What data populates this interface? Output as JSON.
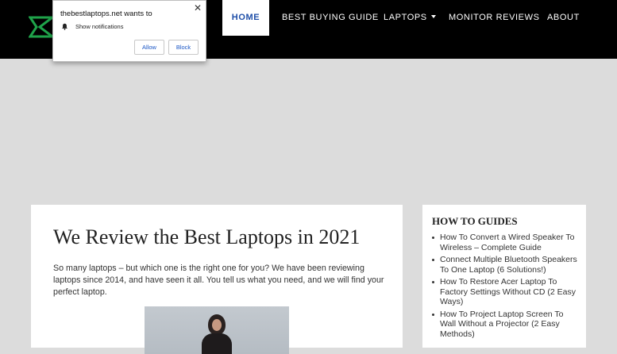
{
  "nav": {
    "items": [
      {
        "label": "HOME",
        "active": true
      },
      {
        "label": "BEST BUYING GUIDE",
        "active": false
      },
      {
        "label": "LAPTOPS",
        "active": false,
        "has_dropdown": true
      },
      {
        "label": "MONITOR REVIEWS",
        "active": false
      },
      {
        "label": "ABOUT",
        "active": false
      }
    ]
  },
  "popup": {
    "title": "thebestlaptops.net wants to",
    "permission": "Show notifications",
    "allow_label": "Allow",
    "block_label": "Block",
    "close_glyph": "✕",
    "icon": "bell-icon"
  },
  "main": {
    "title": "We Review the Best Laptops in 2021",
    "intro": "So many laptops – but which one is the right one for you? We have been reviewing laptops since 2014, and have seen it all. You tell us what you need, and we will find your perfect laptop."
  },
  "sidebar": {
    "title": "HOW TO GUIDES",
    "items": [
      "How To Convert a Wired Speaker To Wireless – Complete Guide",
      "Connect Multiple Bluetooth Speakers To One Laptop (6 Solutions!)",
      "How To Restore Acer Laptop To Factory Settings Without CD (2 Easy Ways)",
      "How To Project Laptop Screen To Wall Without a Projector (2 Easy Methods)"
    ]
  },
  "colors": {
    "topbar": "#000000",
    "page_bg": "#dcdcdc",
    "accent_blue": "#1f4fa8",
    "logo_green": "#1fa34a"
  }
}
